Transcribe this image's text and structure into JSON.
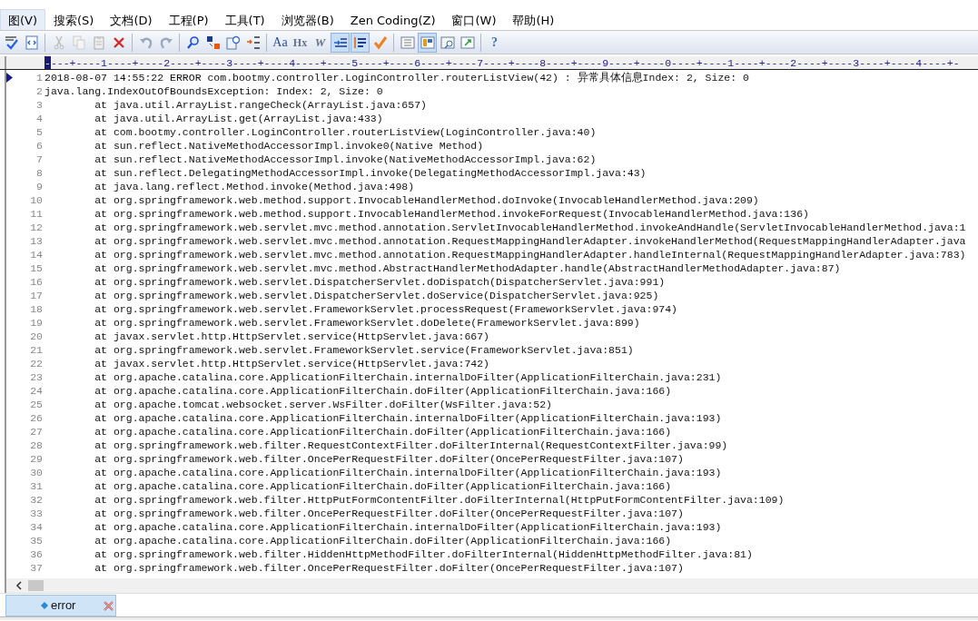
{
  "menu": [
    {
      "label": "图(V)",
      "selected": true
    },
    {
      "label": "搜索(S)",
      "selected": false
    },
    {
      "label": "文档(D)",
      "selected": false
    },
    {
      "label": "工程(P)",
      "selected": false
    },
    {
      "label": "工具(T)",
      "selected": false
    },
    {
      "label": "浏览器(B)",
      "selected": false
    },
    {
      "label": "Zen Coding(Z)",
      "selected": false
    },
    {
      "label": "窗口(W)",
      "selected": false
    },
    {
      "label": "帮助(H)",
      "selected": false
    }
  ],
  "toolbar": [
    {
      "kind": "spell",
      "pressed": false
    },
    {
      "kind": "code",
      "pressed": false
    },
    {
      "kind": "sep"
    },
    {
      "kind": "cut",
      "pressed": false
    },
    {
      "kind": "copy",
      "pressed": false
    },
    {
      "kind": "paste",
      "pressed": false
    },
    {
      "kind": "delete",
      "pressed": false
    },
    {
      "kind": "sep"
    },
    {
      "kind": "undo",
      "pressed": false
    },
    {
      "kind": "redo",
      "pressed": false
    },
    {
      "kind": "sep"
    },
    {
      "kind": "search",
      "pressed": false
    },
    {
      "kind": "replace",
      "pressed": false
    },
    {
      "kind": "docsearch",
      "pressed": false
    },
    {
      "kind": "numlist",
      "pressed": false
    },
    {
      "kind": "sep"
    },
    {
      "kind": "font",
      "pressed": false,
      "glyph": "Aa"
    },
    {
      "kind": "heading",
      "pressed": false,
      "glyph": "Hx"
    },
    {
      "kind": "italic",
      "pressed": false,
      "glyph": "W"
    },
    {
      "kind": "indent",
      "pressed": true
    },
    {
      "kind": "abcd",
      "pressed": true
    },
    {
      "kind": "check",
      "pressed": false
    },
    {
      "kind": "sep"
    },
    {
      "kind": "list",
      "pressed": false
    },
    {
      "kind": "panel",
      "pressed": true
    },
    {
      "kind": "window",
      "pressed": false
    },
    {
      "kind": "export",
      "pressed": false
    },
    {
      "kind": "sep"
    },
    {
      "kind": "help",
      "pressed": false,
      "glyph": "?"
    }
  ],
  "ruler": {
    "cursor": "-",
    "text": "---+----1----+----2----+----3----+----4----+----5----+----6----+----7----+----8----+----9----+----0----+----1----+----2----+----3----+----4----+-"
  },
  "lines": [
    {
      "number": "1",
      "current": true,
      "text": "2018-08-07 14:55:22 ERROR com.bootmy.controller.LoginController.routerListView(42) : 异常具体信息Index: 2, Size: 0"
    },
    {
      "number": "2",
      "current": false,
      "text": "java.lang.IndexOutOfBoundsException: Index: 2, Size: 0"
    },
    {
      "number": "3",
      "current": false,
      "text": "\tat java.util.ArrayList.rangeCheck(ArrayList.java:657)"
    },
    {
      "number": "4",
      "current": false,
      "text": "\tat java.util.ArrayList.get(ArrayList.java:433)"
    },
    {
      "number": "5",
      "current": false,
      "text": "\tat com.bootmy.controller.LoginController.routerListView(LoginController.java:40)"
    },
    {
      "number": "6",
      "current": false,
      "text": "\tat sun.reflect.NativeMethodAccessorImpl.invoke0(Native Method)"
    },
    {
      "number": "7",
      "current": false,
      "text": "\tat sun.reflect.NativeMethodAccessorImpl.invoke(NativeMethodAccessorImpl.java:62)"
    },
    {
      "number": "8",
      "current": false,
      "text": "\tat sun.reflect.DelegatingMethodAccessorImpl.invoke(DelegatingMethodAccessorImpl.java:43)"
    },
    {
      "number": "9",
      "current": false,
      "text": "\tat java.lang.reflect.Method.invoke(Method.java:498)"
    },
    {
      "number": "10",
      "current": false,
      "text": "\tat org.springframework.web.method.support.InvocableHandlerMethod.doInvoke(InvocableHandlerMethod.java:209)"
    },
    {
      "number": "11",
      "current": false,
      "text": "\tat org.springframework.web.method.support.InvocableHandlerMethod.invokeForRequest(InvocableHandlerMethod.java:136)"
    },
    {
      "number": "12",
      "current": false,
      "text": "\tat org.springframework.web.servlet.mvc.method.annotation.ServletInvocableHandlerMethod.invokeAndHandle(ServletInvocableHandlerMethod.java:1"
    },
    {
      "number": "13",
      "current": false,
      "text": "\tat org.springframework.web.servlet.mvc.method.annotation.RequestMappingHandlerAdapter.invokeHandlerMethod(RequestMappingHandlerAdapter.java"
    },
    {
      "number": "14",
      "current": false,
      "text": "\tat org.springframework.web.servlet.mvc.method.annotation.RequestMappingHandlerAdapter.handleInternal(RequestMappingHandlerAdapter.java:783)"
    },
    {
      "number": "15",
      "current": false,
      "text": "\tat org.springframework.web.servlet.mvc.method.AbstractHandlerMethodAdapter.handle(AbstractHandlerMethodAdapter.java:87)"
    },
    {
      "number": "16",
      "current": false,
      "text": "\tat org.springframework.web.servlet.DispatcherServlet.doDispatch(DispatcherServlet.java:991)"
    },
    {
      "number": "17",
      "current": false,
      "text": "\tat org.springframework.web.servlet.DispatcherServlet.doService(DispatcherServlet.java:925)"
    },
    {
      "number": "18",
      "current": false,
      "text": "\tat org.springframework.web.servlet.FrameworkServlet.processRequest(FrameworkServlet.java:974)"
    },
    {
      "number": "19",
      "current": false,
      "text": "\tat org.springframework.web.servlet.FrameworkServlet.doDelete(FrameworkServlet.java:899)"
    },
    {
      "number": "20",
      "current": false,
      "text": "\tat javax.servlet.http.HttpServlet.service(HttpServlet.java:667)"
    },
    {
      "number": "21",
      "current": false,
      "text": "\tat org.springframework.web.servlet.FrameworkServlet.service(FrameworkServlet.java:851)"
    },
    {
      "number": "22",
      "current": false,
      "text": "\tat javax.servlet.http.HttpServlet.service(HttpServlet.java:742)"
    },
    {
      "number": "23",
      "current": false,
      "text": "\tat org.apache.catalina.core.ApplicationFilterChain.internalDoFilter(ApplicationFilterChain.java:231)"
    },
    {
      "number": "24",
      "current": false,
      "text": "\tat org.apache.catalina.core.ApplicationFilterChain.doFilter(ApplicationFilterChain.java:166)"
    },
    {
      "number": "25",
      "current": false,
      "text": "\tat org.apache.tomcat.websocket.server.WsFilter.doFilter(WsFilter.java:52)"
    },
    {
      "number": "26",
      "current": false,
      "text": "\tat org.apache.catalina.core.ApplicationFilterChain.internalDoFilter(ApplicationFilterChain.java:193)"
    },
    {
      "number": "27",
      "current": false,
      "text": "\tat org.apache.catalina.core.ApplicationFilterChain.doFilter(ApplicationFilterChain.java:166)"
    },
    {
      "number": "28",
      "current": false,
      "text": "\tat org.springframework.web.filter.RequestContextFilter.doFilterInternal(RequestContextFilter.java:99)"
    },
    {
      "number": "29",
      "current": false,
      "text": "\tat org.springframework.web.filter.OncePerRequestFilter.doFilter(OncePerRequestFilter.java:107)"
    },
    {
      "number": "30",
      "current": false,
      "text": "\tat org.apache.catalina.core.ApplicationFilterChain.internalDoFilter(ApplicationFilterChain.java:193)"
    },
    {
      "number": "31",
      "current": false,
      "text": "\tat org.apache.catalina.core.ApplicationFilterChain.doFilter(ApplicationFilterChain.java:166)"
    },
    {
      "number": "32",
      "current": false,
      "text": "\tat org.springframework.web.filter.HttpPutFormContentFilter.doFilterInternal(HttpPutFormContentFilter.java:109)"
    },
    {
      "number": "33",
      "current": false,
      "text": "\tat org.springframework.web.filter.OncePerRequestFilter.doFilter(OncePerRequestFilter.java:107)"
    },
    {
      "number": "34",
      "current": false,
      "text": "\tat org.apache.catalina.core.ApplicationFilterChain.internalDoFilter(ApplicationFilterChain.java:193)"
    },
    {
      "number": "35",
      "current": false,
      "text": "\tat org.apache.catalina.core.ApplicationFilterChain.doFilter(ApplicationFilterChain.java:166)"
    },
    {
      "number": "36",
      "current": false,
      "text": "\tat org.springframework.web.filter.HiddenHttpMethodFilter.doFilterInternal(HiddenHttpMethodFilter.java:81)"
    },
    {
      "number": "37",
      "current": false,
      "text": "\tat org.springframework.web.filter.OncePerRequestFilter.doFilter(OncePerRequestFilter.java:107)"
    }
  ],
  "tabs": [
    {
      "label": "error",
      "selected": true
    }
  ]
}
